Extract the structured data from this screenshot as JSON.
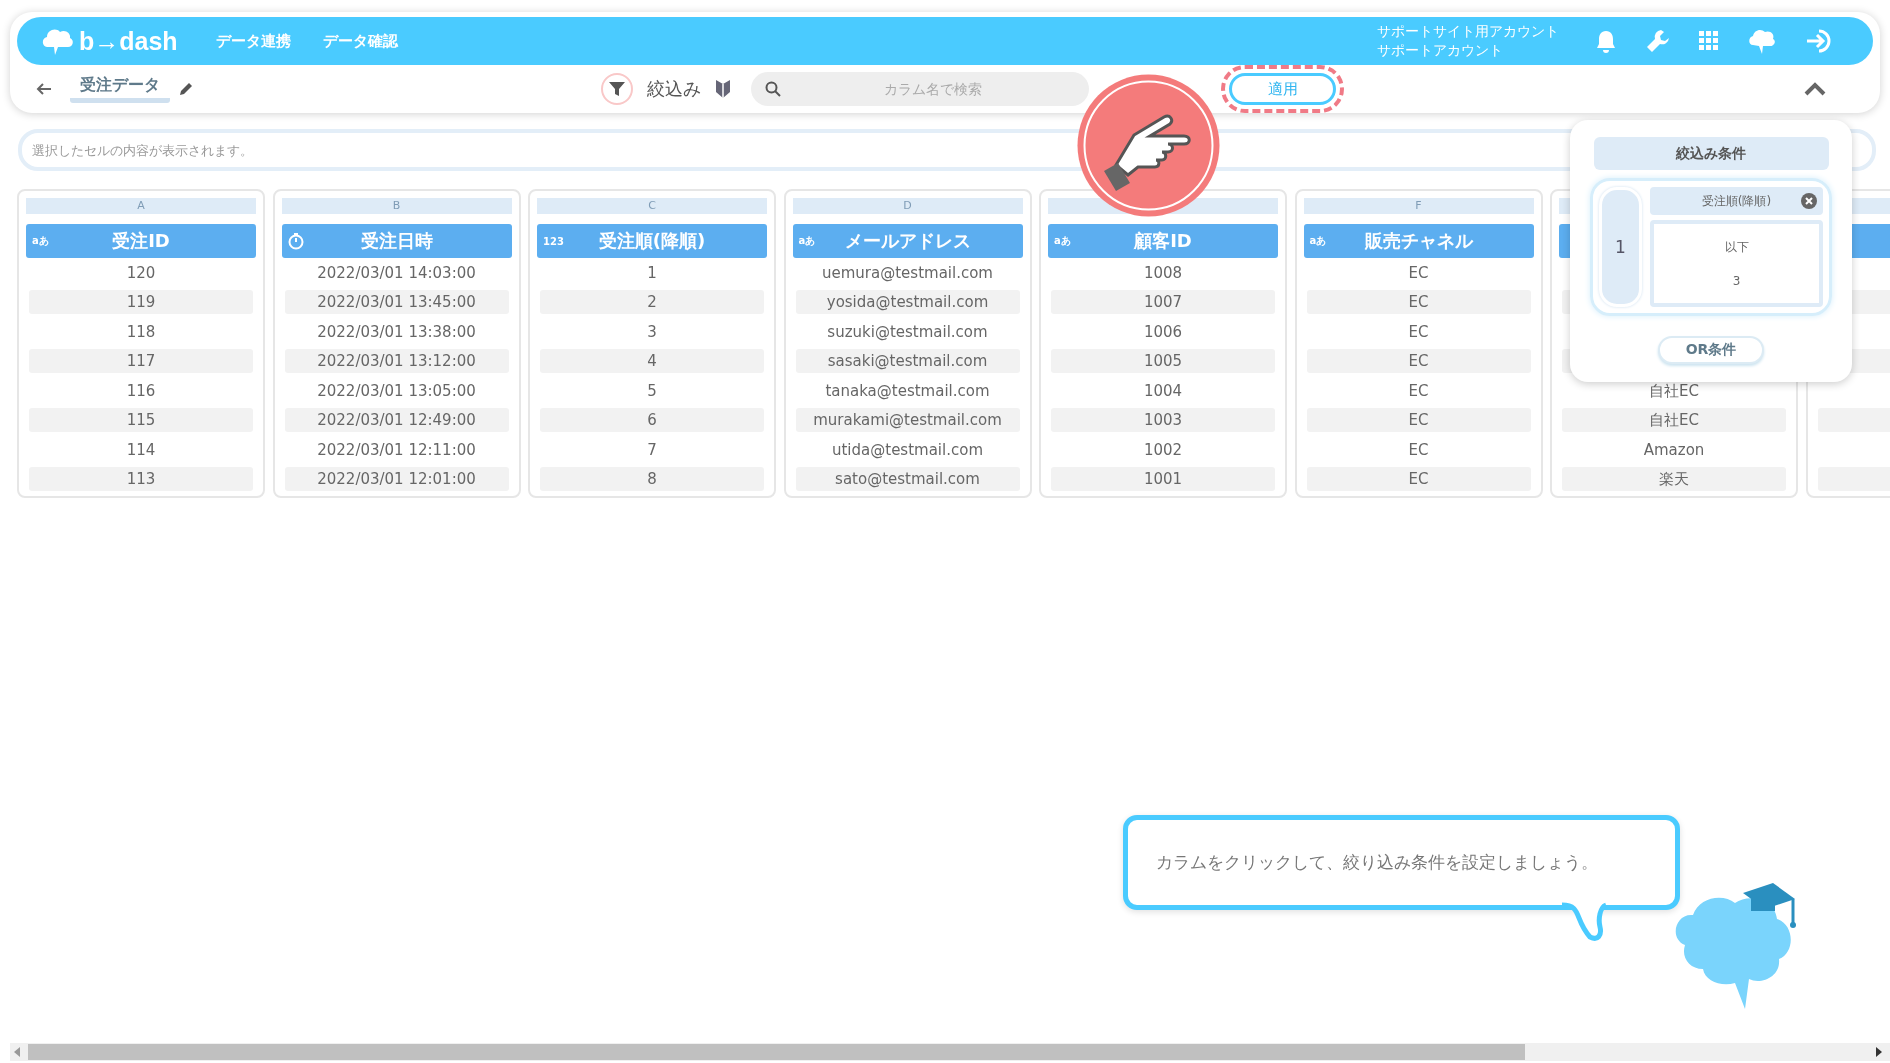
{
  "header": {
    "logo": "b→dash",
    "nav": [
      {
        "label": "データ連携"
      },
      {
        "label": "データ確認"
      }
    ],
    "account": [
      "サポートサイト用アカウント",
      "サポートアカウント"
    ]
  },
  "toolbar": {
    "title": "受注データ",
    "filter_label": "絞込み",
    "search": {
      "placeholder": "カラム名で検索"
    },
    "apply_button": "適用"
  },
  "cell_view": {
    "placeholder": "選択したセルの内容が表示されます。"
  },
  "columns": [
    {
      "letter": "A",
      "kind": "text",
      "type_label": "aあ",
      "title": "受注ID",
      "cells": [
        "120",
        "119",
        "118",
        "117",
        "116",
        "115",
        "114",
        "113"
      ]
    },
    {
      "letter": "B",
      "kind": "datetime",
      "title": "受注日時",
      "cells": [
        "2022/03/01 14:03:00",
        "2022/03/01 13:45:00",
        "2022/03/01 13:38:00",
        "2022/03/01 13:12:00",
        "2022/03/01 13:05:00",
        "2022/03/01 12:49:00",
        "2022/03/01 12:11:00",
        "2022/03/01 12:01:00"
      ]
    },
    {
      "letter": "C",
      "kind": "number",
      "type_label": "123",
      "title": "受注順(降順)",
      "cells": [
        "1",
        "2",
        "3",
        "4",
        "5",
        "6",
        "7",
        "8"
      ]
    },
    {
      "letter": "D",
      "kind": "text",
      "type_label": "aあ",
      "title": "メールアドレス",
      "cells": [
        "uemura@testmail.com",
        "yosida@testmail.com",
        "suzuki@testmail.com",
        "sasaki@testmail.com",
        "tanaka@testmail.com",
        "murakami@testmail.com",
        "utida@testmail.com",
        "sato@testmail.com"
      ]
    },
    {
      "kind": "text",
      "type_label": "aあ",
      "title": "顧客ID",
      "cells": [
        "1008",
        "1007",
        "1006",
        "1005",
        "1004",
        "1003",
        "1002",
        "1001"
      ]
    },
    {
      "letter": "F",
      "kind": "text",
      "type_label": "aあ",
      "title": "販売チャネル",
      "cells": [
        "EC",
        "EC",
        "EC",
        "EC",
        "EC",
        "EC",
        "EC",
        "EC"
      ]
    },
    {
      "kind": "text",
      "cells": [
        null,
        null,
        null,
        null,
        "自社EC",
        "自社EC",
        "Amazon",
        "楽天"
      ]
    },
    {
      "kind": "text",
      "cells": [
        null,
        null,
        null,
        null,
        null,
        null,
        null,
        null
      ]
    }
  ],
  "filter_panel": {
    "title": "絞込み条件",
    "groups": [
      {
        "number": "1",
        "conditions": [
          {
            "column": "受注順(降順)",
            "operator": "以下",
            "value": "3"
          }
        ]
      }
    ],
    "or_button": "OR条件"
  },
  "tip": {
    "text": "カラムをクリックして、絞り込み条件を設定しましょう。"
  }
}
